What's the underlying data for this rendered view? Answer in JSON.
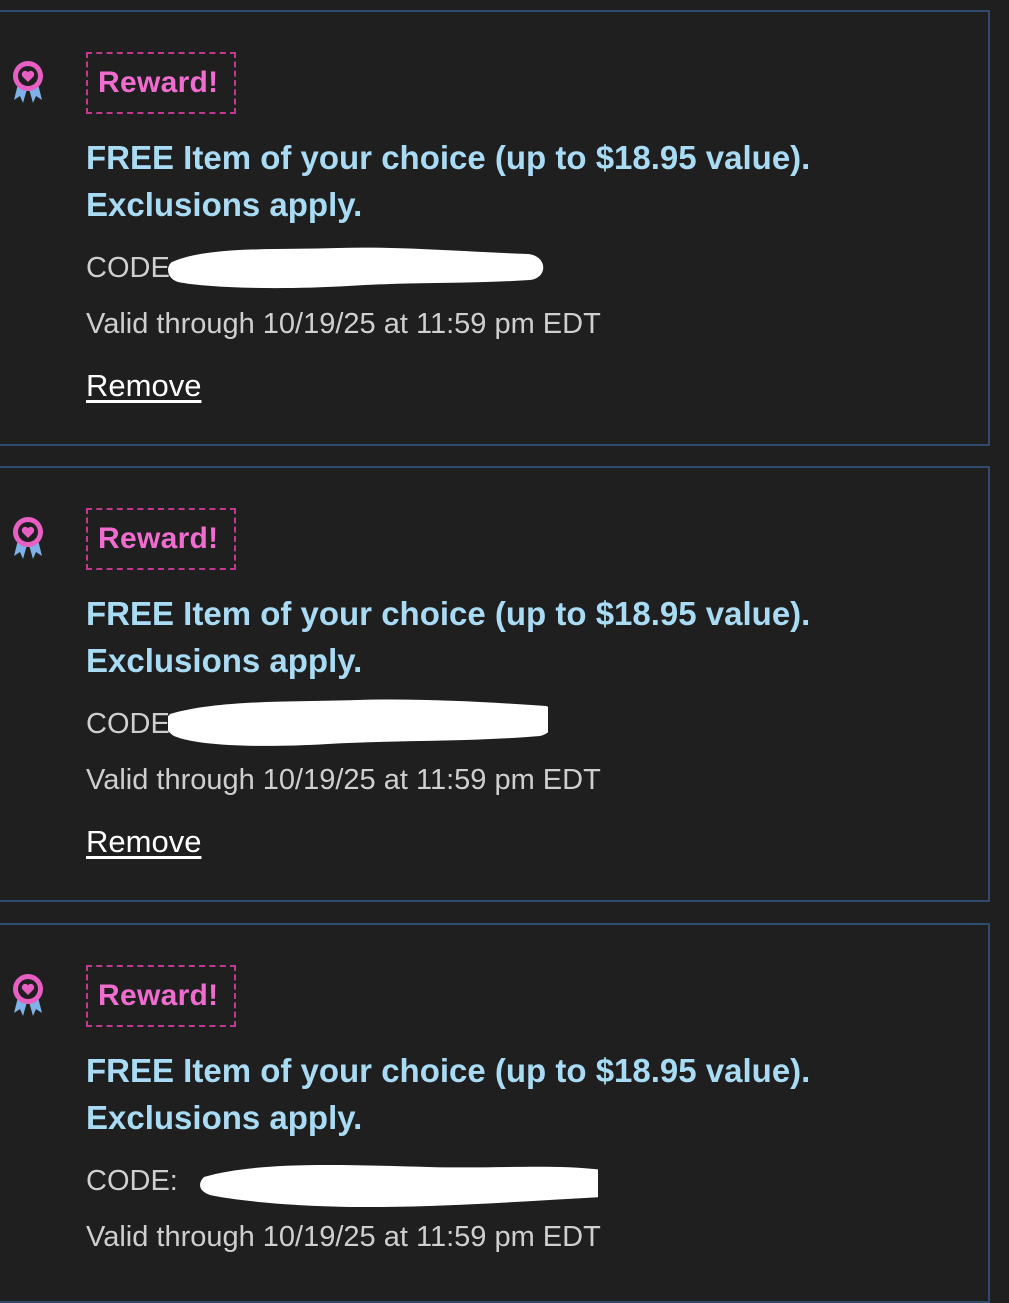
{
  "rewards": [
    {
      "tag": "Reward!",
      "offer": "FREE Item of your choice (up to $18.95 value). Exclusions apply.",
      "code_label": "CODE:",
      "valid": "Valid through 10/19/25 at 11:59 pm EDT",
      "remove": "Remove"
    },
    {
      "tag": "Reward!",
      "offer": "FREE Item of your choice (up to $18.95 value). Exclusions apply.",
      "code_label": "CODE:",
      "valid": "Valid through 10/19/25 at 11:59 pm EDT",
      "remove": "Remove"
    },
    {
      "tag": "Reward!",
      "offer": "FREE Item of your choice (up to $18.95 value). Exclusions apply.",
      "code_label": "CODE:",
      "valid": "Valid through 10/19/25 at 11:59 pm EDT"
    }
  ],
  "icons": {
    "reward": "award-ribbon-heart-icon"
  },
  "colors": {
    "background": "#1f1f20",
    "card_border": "#2e4a6e",
    "tag_text": "#f06dcf",
    "tag_border": "#c2398f",
    "offer_text": "#a9dcf4",
    "meta_text": "#cfcfcf",
    "link_text": "#ffffff",
    "icon_pink": "#e85fc4",
    "icon_blue": "#7fb2e6"
  }
}
